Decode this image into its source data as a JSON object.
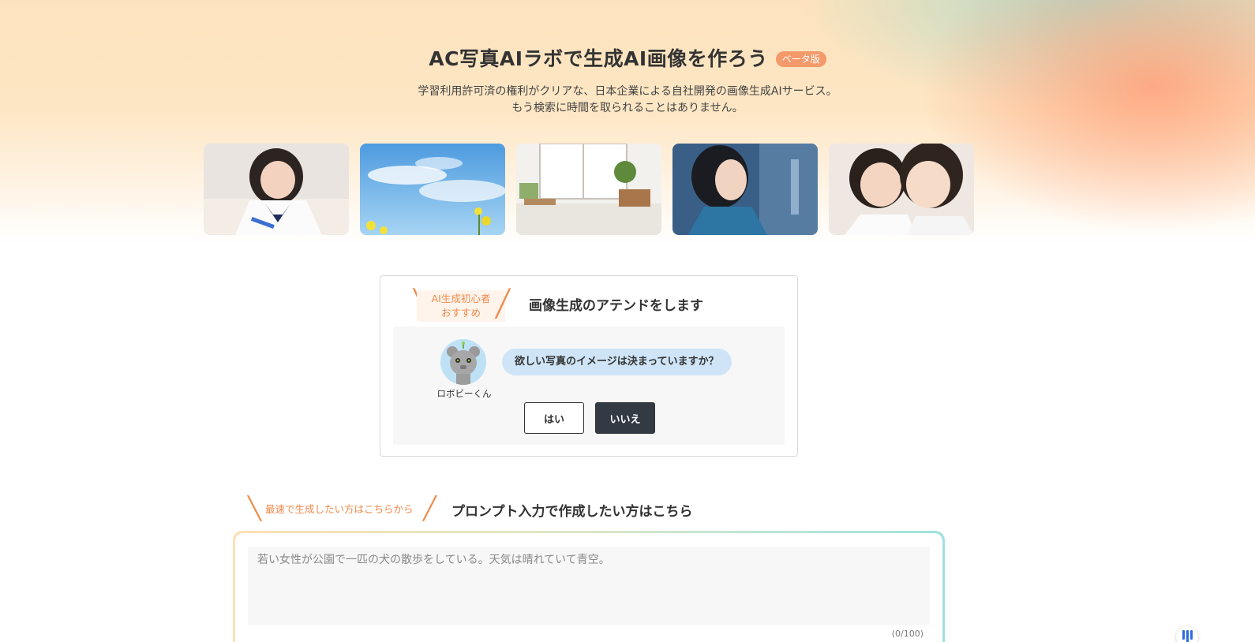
{
  "hero": {
    "title": "AC写真AIラボで生成AI画像を作ろう",
    "beta_badge": "ベータ版",
    "subtitle_line1": "学習利用許可済の権利がクリアな、日本企業による自社開発の画像生成AIサービス。",
    "subtitle_line2": "もう検索に時間を取られることはありません。"
  },
  "gallery": {
    "images": [
      {
        "icon": "student-writing-image"
      },
      {
        "icon": "sky-flowers-image"
      },
      {
        "icon": "interior-room-image"
      },
      {
        "icon": "woman-profile-image"
      },
      {
        "icon": "children-smiling-image"
      }
    ]
  },
  "attend": {
    "tag_line1": "AI生成初心者",
    "tag_line2": "おすすめ",
    "title": "画像生成のアテンドをします",
    "avatar_name": "ロボビーくん",
    "question": "欲しい写真のイメージは決まっていますか？",
    "yes_label": "はい",
    "no_label": "いいえ"
  },
  "prompt": {
    "tag": "最速で生成したい方はこちらから",
    "title": "プロンプト入力で作成したい方はこちら",
    "placeholder": "若い女性が公園で一匹の犬の散歩をしている。天気は晴れていて青空。",
    "count": "(0/100)"
  },
  "colors": {
    "accent_orange": "#f08a4b",
    "badge": "#f49a6a",
    "dark_button": "#333a44",
    "bubble": "#cfe5f7"
  }
}
